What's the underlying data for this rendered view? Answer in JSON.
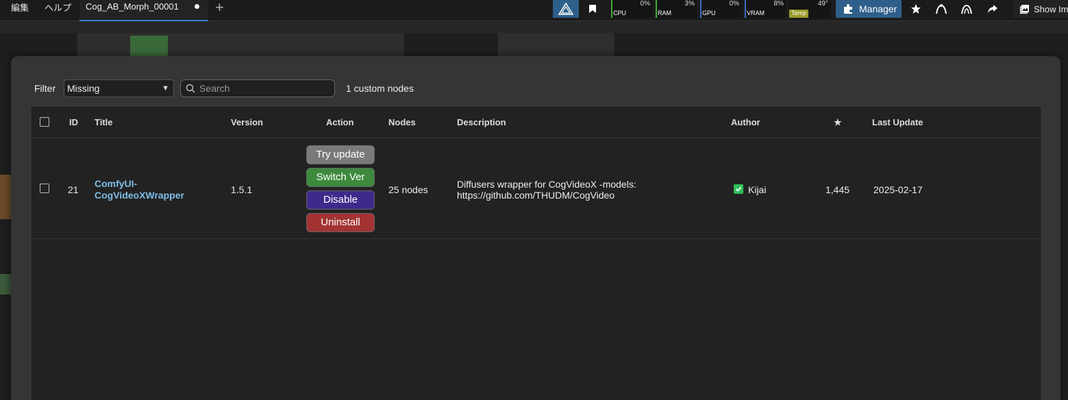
{
  "menu": {
    "edit": "編集",
    "help": "ヘルプ"
  },
  "tab": {
    "title": "Cog_AB_Morph_00001",
    "add_label": "+"
  },
  "monitors": [
    {
      "label": "CPU",
      "value": "0%",
      "color": "#3fae3f"
    },
    {
      "label": "RAM",
      "value": "3%",
      "color": "#3fae3f"
    },
    {
      "label": "GPU",
      "value": "0%",
      "color": "#3a6fc4"
    },
    {
      "label": "VRAM",
      "value": "8%",
      "color": "#3a6fc4"
    },
    {
      "label": "Temp",
      "value": "49°",
      "color": "#9a9a2a"
    }
  ],
  "toolbar": {
    "manager_label": "Manager",
    "show_label": "Show Im"
  },
  "dialog": {
    "filter_label": "Filter",
    "filter_value": "Missing",
    "search_placeholder": "Search",
    "count_label": "1 custom nodes",
    "headers": {
      "id": "ID",
      "title": "Title",
      "version": "Version",
      "action": "Action",
      "nodes": "Nodes",
      "description": "Description",
      "author": "Author",
      "stars": "★",
      "last_update": "Last Update"
    },
    "rows": [
      {
        "id": "21",
        "title_line1": "ComfyUI-",
        "title_line2": "CogVideoXWrapper",
        "version": "1.5.1",
        "actions": {
          "try_update": "Try update",
          "switch_ver": "Switch Ver",
          "disable": "Disable",
          "uninstall": "Uninstall"
        },
        "nodes": "25 nodes",
        "description_line1": "Diffusers wrapper for CogVideoX -models:",
        "description_line2": "https://github.com/THUDM/CogVideo",
        "author": "Kijai",
        "stars": "1,445",
        "last_update": "2025-02-17"
      }
    ]
  },
  "colors": {
    "try_update": "#7a7a7a",
    "switch_ver": "#3d8a3d",
    "disable": "#3f2a8c",
    "uninstall": "#a33333",
    "manager": "#2e5f8a"
  }
}
